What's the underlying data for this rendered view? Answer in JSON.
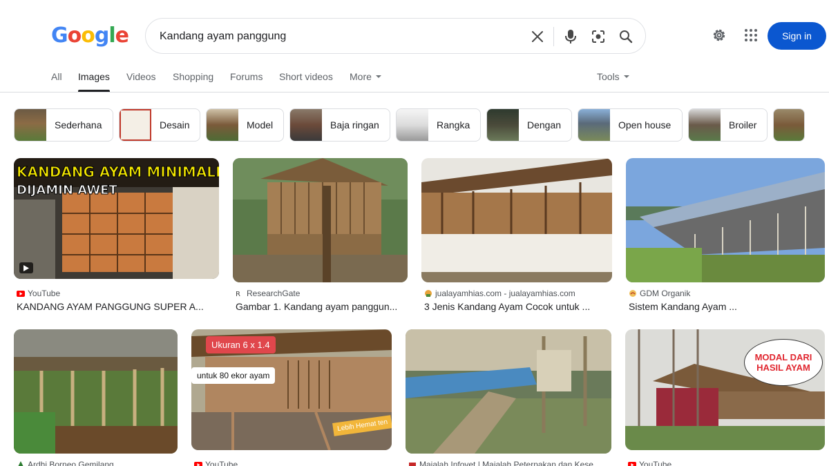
{
  "logo": {
    "letters": [
      "G",
      "o",
      "o",
      "g",
      "l",
      "e"
    ],
    "colors": [
      "#4285f4",
      "#ea4335",
      "#fbbc05",
      "#4285f4",
      "#34a853",
      "#ea4335"
    ]
  },
  "search": {
    "query": "Kandang ayam panggung"
  },
  "header": {
    "signin_label": "Sign in"
  },
  "tabs": [
    {
      "label": "All"
    },
    {
      "label": "Images"
    },
    {
      "label": "Videos"
    },
    {
      "label": "Shopping"
    },
    {
      "label": "Forums"
    },
    {
      "label": "Short videos"
    },
    {
      "label": "More"
    }
  ],
  "tools_label": "Tools",
  "chips": [
    {
      "label": "Sederhana"
    },
    {
      "label": "Desain"
    },
    {
      "label": "Model"
    },
    {
      "label": "Baja ringan"
    },
    {
      "label": "Rangka"
    },
    {
      "label": "Dengan"
    },
    {
      "label": "Open house"
    },
    {
      "label": "Broiler"
    }
  ],
  "results": [
    {
      "source": "YouTube",
      "title": "KANDANG AYAM PANGGUNG SUPER A...",
      "overlay": [
        "KANDANG AYAM MINIMALIS",
        "DIJAMIN AWET"
      ]
    },
    {
      "source": "ResearchGate",
      "title": "Gambar 1. Kandang ayam panggun..."
    },
    {
      "source": "jualayamhias.com - jualayamhias.com",
      "title": "3 Jenis Kandang Ayam Cocok untuk ..."
    },
    {
      "source": "GDM Organik",
      "title": "Sistem Kandang Ayam ..."
    },
    {
      "source": "Ardhi Borneo Gemilang",
      "title": ""
    },
    {
      "source": "YouTube",
      "title": "",
      "overlay": [
        "Ukuran 6 x 1.4",
        "untuk 80 ekor ayam",
        "Lebih Hemat ten"
      ]
    },
    {
      "source": "Majalah Infovet | Majalah Peternakan dan Kese...",
      "title": ""
    },
    {
      "source": "YouTube",
      "title": "",
      "overlay": [
        "MODAL DARI",
        "HASIL AYAM"
      ]
    }
  ],
  "colors": {
    "accent": "#0b57d0",
    "youtube": "#ff0000"
  }
}
